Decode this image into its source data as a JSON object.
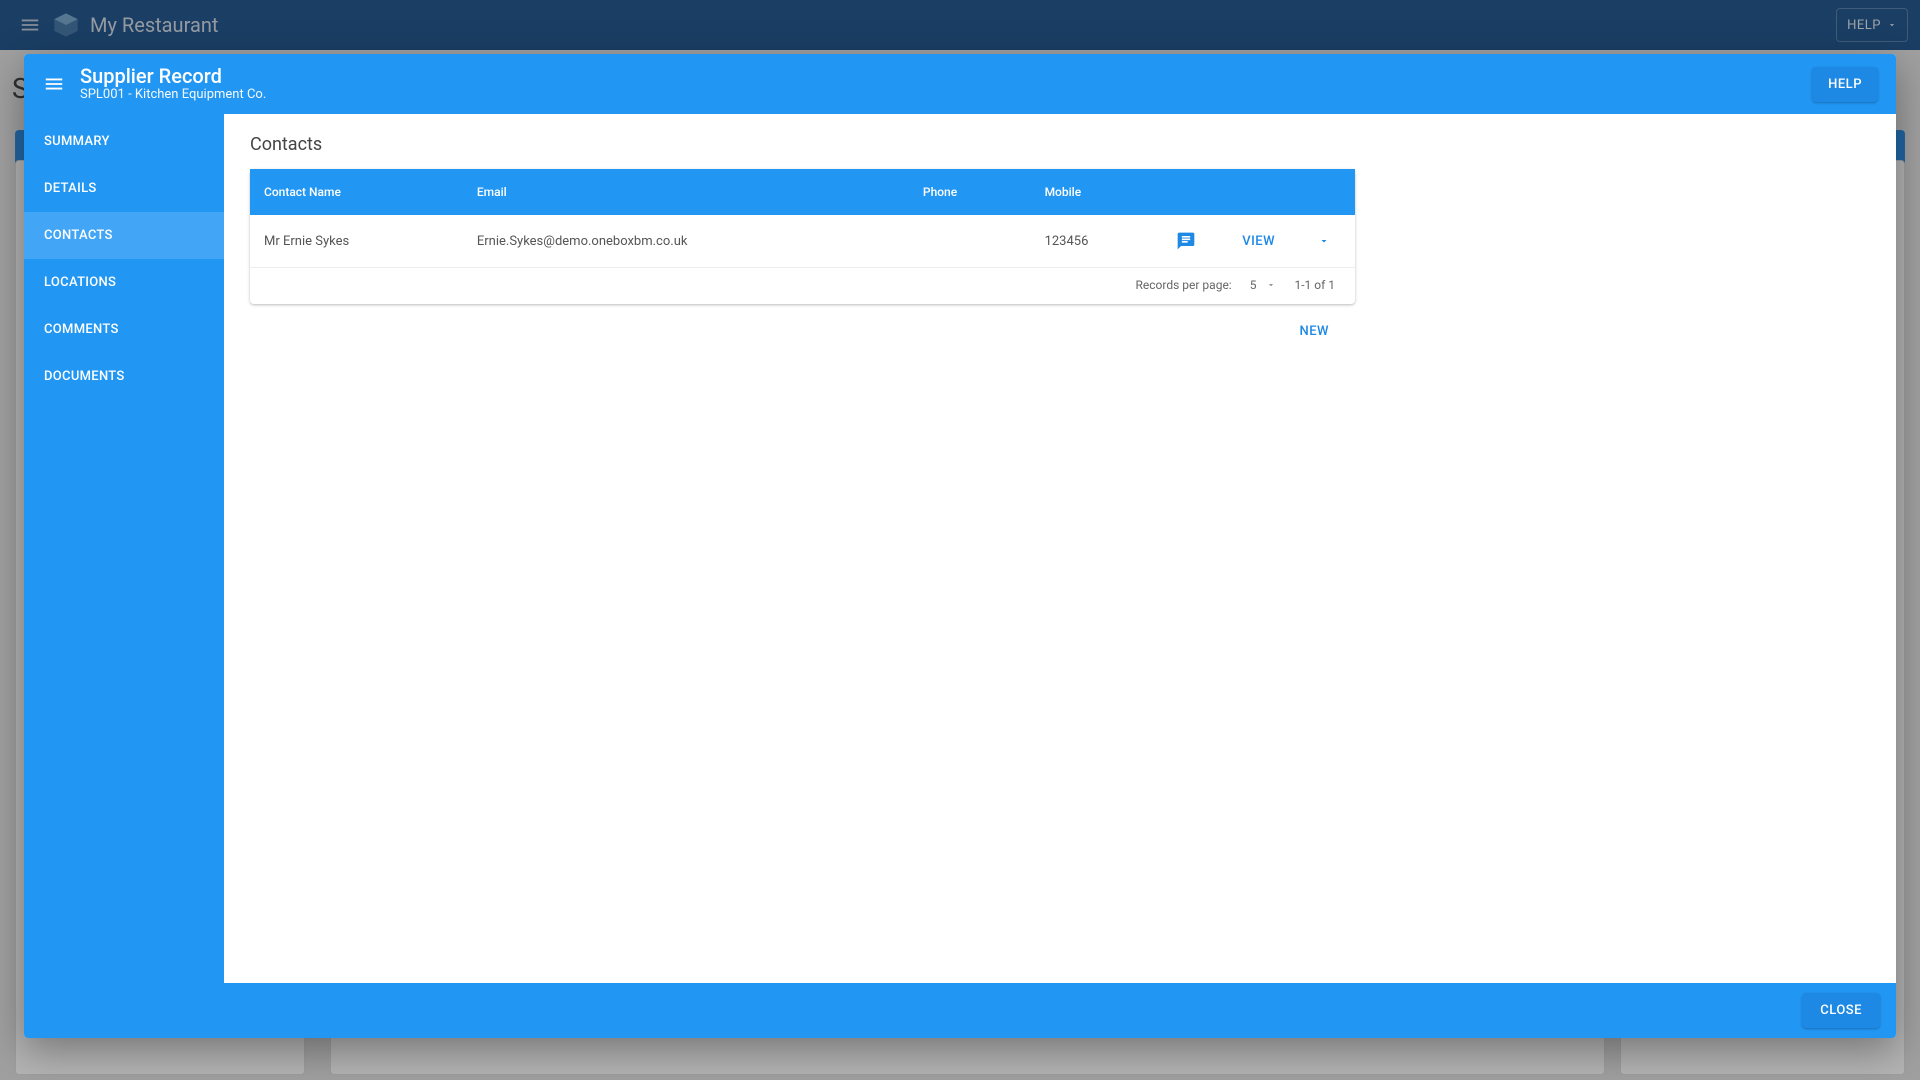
{
  "appbar": {
    "title": "My Restaurant",
    "help_label": "HELP"
  },
  "modal": {
    "title": "Supplier Record",
    "subtitle": "SPL001 - Kitchen Equipment Co.",
    "help_label": "HELP",
    "close_label": "CLOSE"
  },
  "sidebar": {
    "items": [
      {
        "label": "SUMMARY"
      },
      {
        "label": "DETAILS"
      },
      {
        "label": "CONTACTS"
      },
      {
        "label": "LOCATIONS"
      },
      {
        "label": "COMMENTS"
      },
      {
        "label": "DOCUMENTS"
      }
    ],
    "active_index": 2
  },
  "contacts": {
    "heading": "Contacts",
    "columns": {
      "name": "Contact Name",
      "email": "Email",
      "phone": "Phone",
      "mobile": "Mobile"
    },
    "rows": [
      {
        "name": "Mr Ernie Sykes",
        "email": "Ernie.Sykes@demo.oneboxbm.co.uk",
        "phone": "",
        "mobile": "123456",
        "view_label": "VIEW"
      }
    ],
    "pager": {
      "records_label": "Records per page:",
      "page_size": "5",
      "range": "1-1 of 1"
    },
    "new_label": "NEW"
  }
}
